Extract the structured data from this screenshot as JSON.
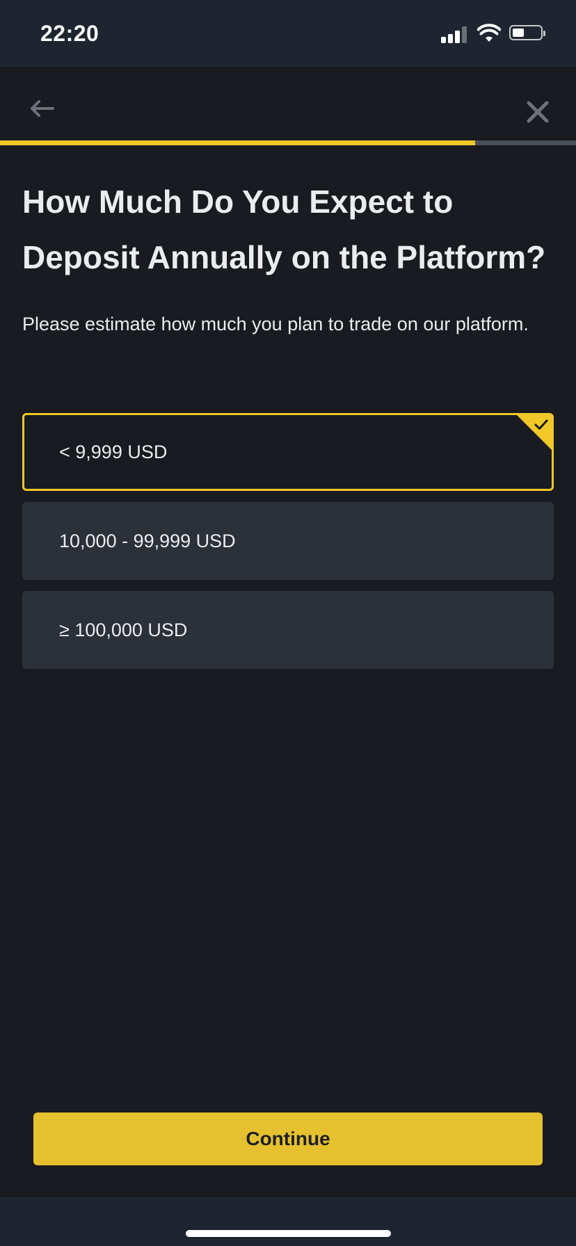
{
  "status_bar": {
    "time": "22:20",
    "icons": [
      "signal-icon",
      "wifi-icon",
      "battery-icon"
    ]
  },
  "nav": {
    "back_icon": "arrow-left-icon",
    "close_icon": "close-icon",
    "progress": 0.825
  },
  "question": {
    "title": "How Much Do You Expect to Deposit Annually on the Platform?",
    "subtitle": "Please estimate how much you plan to trade on our platform."
  },
  "options": [
    {
      "label": "< 9,999 USD",
      "selected": true
    },
    {
      "label": "10,000 - 99,999 USD",
      "selected": false
    },
    {
      "label": "≥ 100,000 USD",
      "selected": false
    }
  ],
  "actions": {
    "continue_label": "Continue"
  },
  "colors": {
    "accent": "#f0c928",
    "button": "#e6c12f",
    "background": "#1a1b20",
    "option_background": "#2b3039",
    "text": "#eaecef"
  }
}
